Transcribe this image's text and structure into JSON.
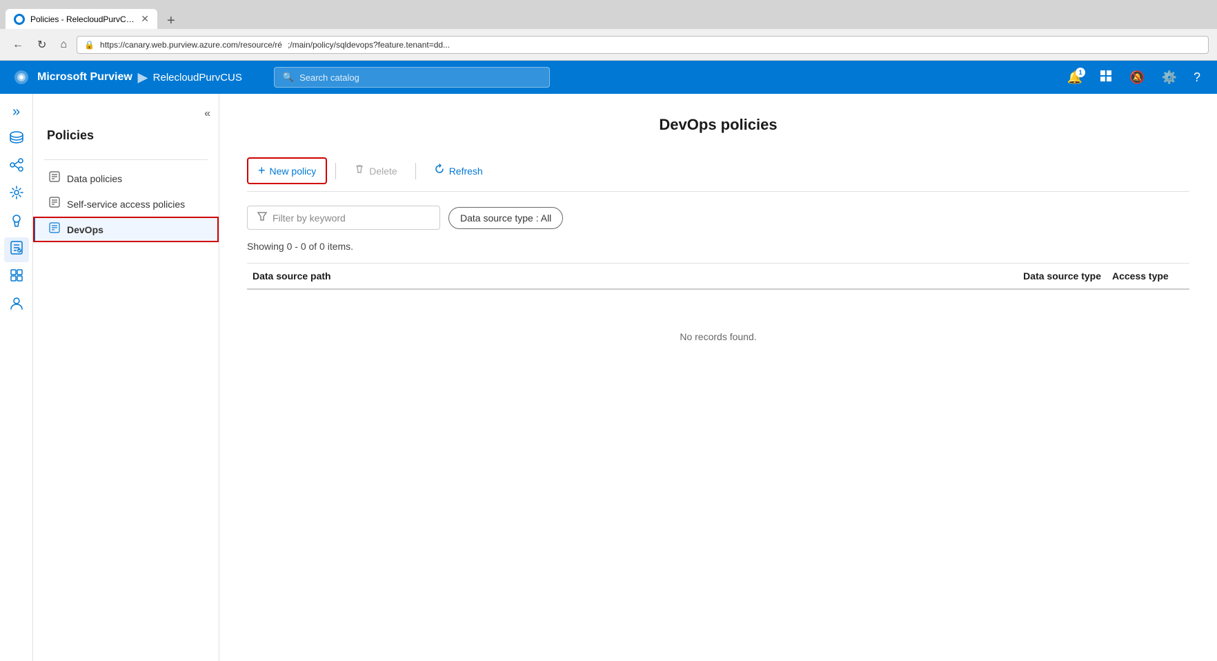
{
  "browser": {
    "tab_title": "Policies - RelecloudPurvCUS - M",
    "tab_new_label": "+",
    "url_left": "https://canary.web.purview.azure.com/resource/ré",
    "url_right": ";/main/policy/sqldevops?feature.tenant=dd...",
    "nav_back": "←",
    "nav_forward": "→",
    "nav_refresh": "↻",
    "nav_home": "⌂"
  },
  "header": {
    "brand": "Microsoft Purview",
    "separator": "▶",
    "instance": "RelecloudPurvCUS",
    "search_placeholder": "Search catalog",
    "search_icon": "🔍",
    "notification_count": "1",
    "icons": {
      "notification": "🔔",
      "layout": "⊠",
      "settings": "⚙",
      "help": "?"
    }
  },
  "sidebar": {
    "title": "Policies",
    "items": [
      {
        "label": "Data policies",
        "icon": "☰"
      },
      {
        "label": "Self-service access policies",
        "icon": "☰"
      },
      {
        "label": "DevOps",
        "icon": "☰",
        "active": true
      }
    ]
  },
  "main": {
    "page_title": "DevOps policies",
    "toolbar": {
      "new_policy_label": "New policy",
      "delete_label": "Delete",
      "refresh_label": "Refresh"
    },
    "filters": {
      "keyword_placeholder": "Filter by keyword",
      "datasource_filter_label": "Data source type : All"
    },
    "count_text": "Showing 0 - 0 of 0 items.",
    "table": {
      "col_path": "Data source path",
      "col_type": "Data source type",
      "col_access": "Access type",
      "no_records": "No records found."
    }
  },
  "icon_nav": {
    "items": [
      {
        "icon": "»",
        "name": "expand"
      },
      {
        "icon": "🗃",
        "name": "data-catalog"
      },
      {
        "icon": "🔗",
        "name": "connections"
      },
      {
        "icon": "⚙",
        "name": "manage"
      },
      {
        "icon": "💡",
        "name": "insights"
      },
      {
        "icon": "📄",
        "name": "policies",
        "active": true
      },
      {
        "icon": "💼",
        "name": "tools"
      },
      {
        "icon": "👤",
        "name": "account"
      }
    ]
  }
}
